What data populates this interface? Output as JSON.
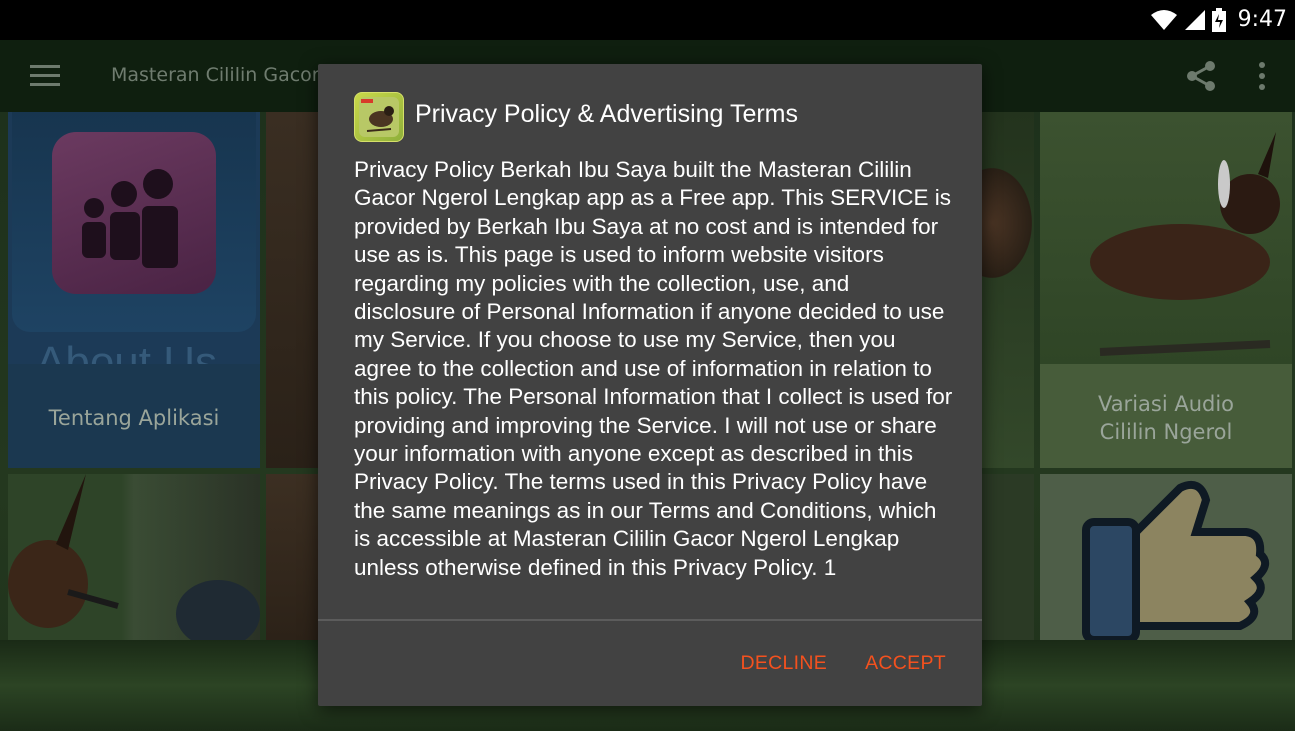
{
  "status_bar": {
    "time": "9:47",
    "icons": [
      "wifi-icon",
      "signal-icon",
      "battery-icon"
    ]
  },
  "app_bar": {
    "title": "Masteran Cililin Gacor",
    "icons": [
      "menu-icon",
      "share-icon",
      "overflow-menu-icon"
    ]
  },
  "tiles": {
    "about_label": "Tentang Aplikasi",
    "about_image_text": "About Us",
    "audio_label": "Variasi Audio Cililin Ngerol"
  },
  "dialog": {
    "title": "Privacy Policy & Advertising Terms",
    "body": "Privacy Policy Berkah Ibu Saya built the Masteran Cililin Gacor Ngerol Lengkap app as a Free app. This SERVICE is provided by Berkah Ibu Saya at no cost and is intended for use as is. This page is used to inform website visitors regarding my policies with the collection, use, and disclosure of Personal Information if anyone decided to use my Service. If you choose to use my Service, then you agree to the collection and use of information in relation to this policy. The Personal Information that I collect is used for providing and improving the Service. I will not use or share your information with anyone except as described in this Privacy Policy. The terms used in this Privacy Policy have the same meanings as in our Terms and Conditions, which is accessible at Masteran Cililin Gacor Ngerol Lengkap unless otherwise defined in this Privacy Policy. 1",
    "decline_label": "DECLINE",
    "accept_label": "ACCEPT"
  },
  "colors": {
    "accent": "#f4511e",
    "dialog_bg": "#424242",
    "app_bar_bg": "#0f1f0f"
  }
}
